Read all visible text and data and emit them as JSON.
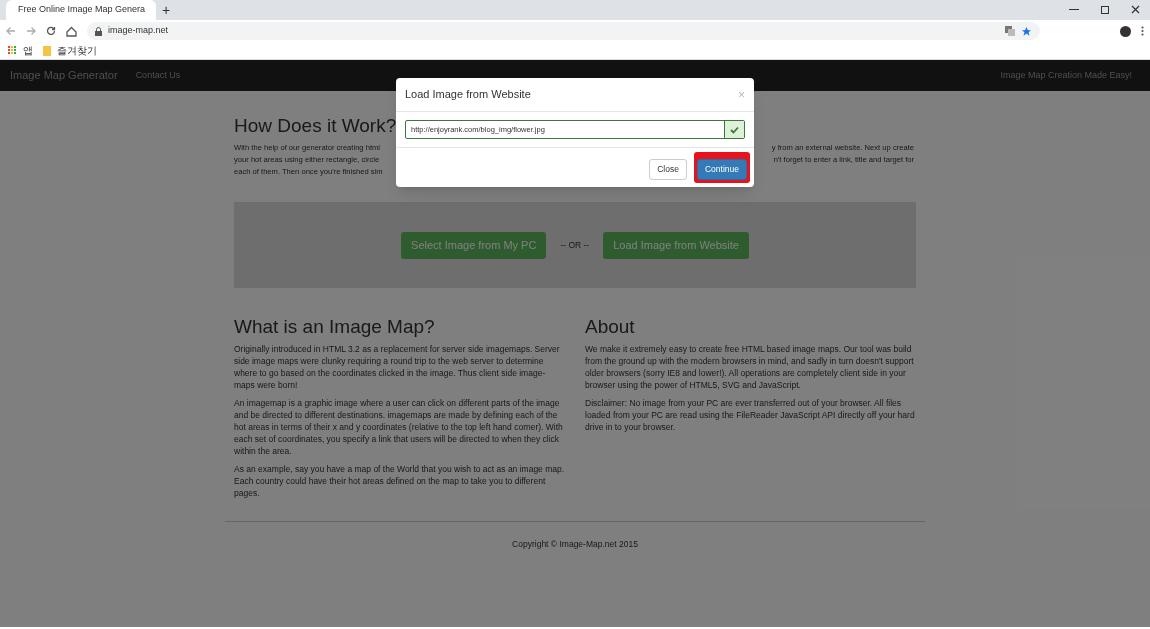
{
  "browser": {
    "tab_title": "Free Online Image Map Genera",
    "new_tab": "+",
    "url": "image-map.net",
    "bookmarks": [
      {
        "label": "앱",
        "kind": "apps"
      },
      {
        "label": "즐겨찾기",
        "kind": "folder"
      }
    ]
  },
  "navbar": {
    "brand": "Image Map Generator",
    "links": [
      "Contact Us"
    ],
    "tagline": "Image Map Creation Made Easy!"
  },
  "intro": {
    "heading": "How Does it Work?",
    "lines": [
      {
        "left": "With the help of our generator creating html",
        "right": "y from an external website. Next up create"
      },
      {
        "left": "your hot areas using either rectangle, circle",
        "right": "n't forget to enter a link, title and target for"
      },
      {
        "left": "each of them. Then once you're finished sim"
      }
    ]
  },
  "upload": {
    "buttons": [
      "Select Image from My PC",
      "Load Image from Website"
    ],
    "separator": "-- OR --"
  },
  "sections": [
    {
      "heading": "What is an Image Map?",
      "paragraphs": [
        "Originally introduced in HTML 3.2 as a replacement for server side imagemaps. Server side image maps were clunky requiring a round trip to the web server to determine where to go based on the coordinates clicked in the image. Thus client side image-maps were born!",
        "An imagemap is a graphic image where a user can click on different parts of the image and be directed to different destinations. imagemaps are made by defining each of the hot areas in terms of their x and y coordinates (relative to the top left hand corner). With each set of coordinates, you specify a link that users will be directed to when they click within the area.",
        "As an example, say you have a map of the World that you wish to act as an image map. Each country could have their hot areas defined on the map to take you to different pages."
      ]
    },
    {
      "heading": "About",
      "paragraphs": [
        "We make it extremely easy to create free HTML based image maps. Our tool was build from the ground up with the modern browsers in mind, and sadly in turn doesn't support older browsers (sorry IE8 and lower!). All operations are completely client side in your browser using the power of HTML5, SVG and JavaScript.",
        "Disclaimer: No image from your PC are ever transferred out of your browser. All files loaded from your PC are read using the FileReader JavaScript API directly off your hard drive in to your browser."
      ]
    }
  ],
  "footer": "Copyright © Image-Map.net 2015",
  "modal": {
    "title": "Load Image from Website",
    "close_x": "×",
    "url_value": "http://enjoyrank.com/blog_img/flower.jpg",
    "valid": true,
    "buttons": [
      {
        "label": "Close",
        "kind": "default",
        "highlighted": false
      },
      {
        "label": "Continue",
        "kind": "primary",
        "highlighted": true
      }
    ]
  }
}
